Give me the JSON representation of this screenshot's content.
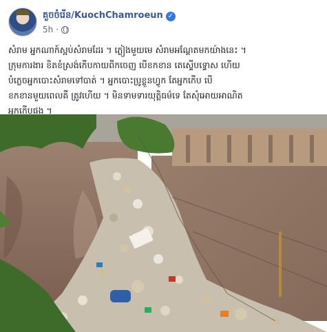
{
  "post": {
    "author": "គួចចំរើន/KuochChamroeun",
    "time": "5h",
    "dot": "·",
    "verified_glyph": "✓",
    "text": "សំរាម អ្នកណាក៍ស្អប់សំរាមដែរ ។ ភ្លៀងមួយមេ សំរាមអណ្តែតមកយ៉ាងនេះ ។\nក្រុមការងារ ខិតខំស្រង់កើបកាយពីកចេញ បើខកខាន តេស្ទើបទ្វោស ហើយ\nបំភ្លេចអ្នកបោះសំរាមទៅបាត់ ។ អ្នកបោះប្រូខ្លួនហ្វូក តែអ្នកកើប បើ\nខកខានមួយពេលគឺ ត្រូវហើយ ។ មិនទាមទារយុត្តិធម៌ទេ តែសុំអោយអាណិត\nអ្នកកើបផង ។"
  },
  "colors": {
    "link": "#385898",
    "verified": "#3578e5",
    "water": "#8a6f5e",
    "grass": "#3f6b2a"
  }
}
